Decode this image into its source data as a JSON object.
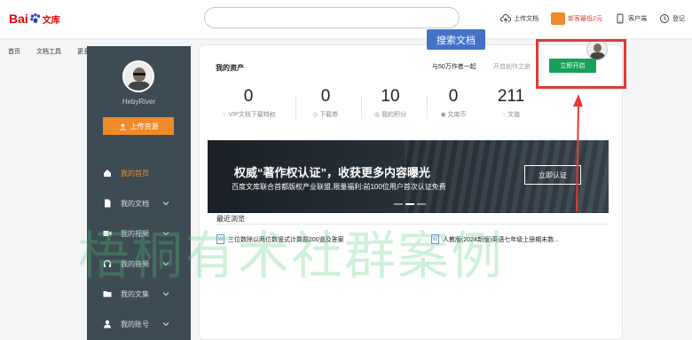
{
  "header": {
    "logo_bai": "Bai",
    "logo_wenku": "文库",
    "search_placeholder": "",
    "actions": [
      {
        "icon": "cloud-upload-icon",
        "label": "上传文档"
      },
      {
        "icon": "vip-icon",
        "label": "新客最低2元"
      },
      {
        "icon": "phone-icon",
        "label": "客户端"
      },
      {
        "icon": "clock-icon",
        "label": "登记"
      }
    ]
  },
  "left_links": [
    "首页",
    "文档工具",
    "更多"
  ],
  "sidebar": {
    "username": "HebyRiver",
    "upload_label": "上传资源",
    "items": [
      {
        "label": "我的首页",
        "icon": "home-icon",
        "active": true
      },
      {
        "label": "我的文档",
        "icon": "document-icon",
        "active": false
      },
      {
        "label": "我的视频",
        "icon": "video-icon",
        "active": false
      },
      {
        "label": "我的音频",
        "icon": "headphones-icon",
        "active": false
      },
      {
        "label": "我的文集",
        "icon": "folder-icon",
        "active": false
      },
      {
        "label": "我的账号",
        "icon": "user-icon",
        "active": false
      }
    ]
  },
  "main": {
    "assets_title": "我的资产",
    "tip_text": "与50万作者一起",
    "tip_text2": "开启创作之旅",
    "search_doc_tag": "搜索文档",
    "start_button": "立即开启",
    "stats": [
      {
        "value": "0",
        "label": "VIP文档下载特权",
        "icon": "diamond-icon"
      },
      {
        "value": "0",
        "label": "下载券",
        "icon": "ticket-icon"
      },
      {
        "value": "10",
        "label": "我的积分",
        "icon": "points-icon"
      },
      {
        "value": "0",
        "label": "文库币",
        "icon": "coin-icon"
      },
      {
        "value": "211",
        "label": "文值",
        "icon": "value-icon"
      }
    ],
    "banner": {
      "title": "权威“著作权认证”，收获更多内容曝光",
      "subtitle": "百度文库联合首都版权产业联盟,限量福利:前100位用户首次认证免费",
      "button": "立即认证"
    },
    "recent_title": "最近浏览",
    "recent_docs": [
      {
        "title": "三位数除以两位数竖式计算题200道及答案"
      },
      {
        "title": "人教版(2024新版)英语七年级上册期末数..."
      }
    ]
  },
  "watermark": "梧桐有术社群案例",
  "colors": {
    "accent_orange": "#f08a28",
    "sidebar_bg": "#3d4b55",
    "green_button": "#19a05c",
    "blue_tag": "#4472c8",
    "annotation_red": "#e53935"
  }
}
